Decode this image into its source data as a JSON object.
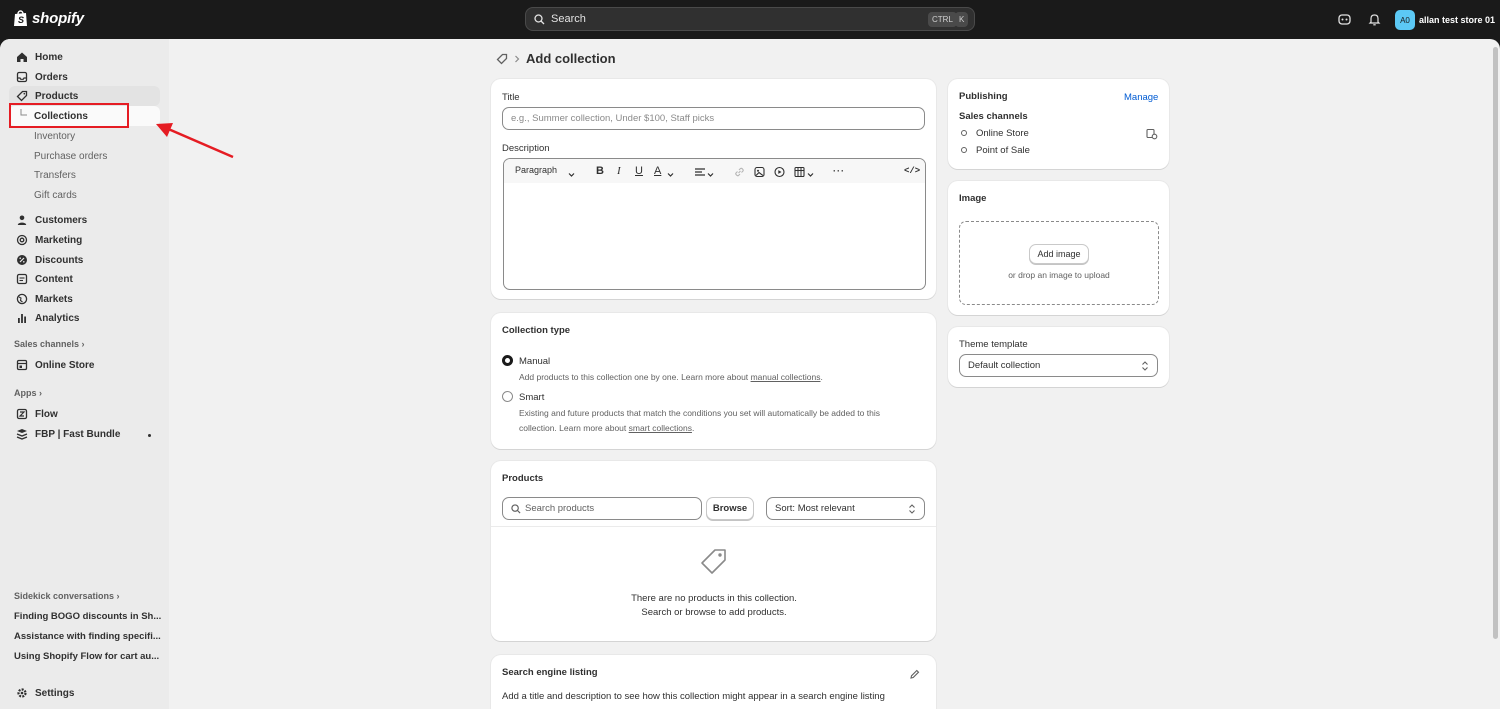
{
  "topbar": {
    "brand": "shopify",
    "search_label": "Search",
    "kbd_ctrl": "CTRL",
    "kbd_k": "K",
    "store_initials": "A0",
    "store_name": "allan test store 01"
  },
  "sidebar": {
    "items": {
      "home": "Home",
      "orders": "Orders",
      "products": "Products",
      "collections": "Collections",
      "inventory": "Inventory",
      "purchase_orders": "Purchase orders",
      "transfers": "Transfers",
      "gift_cards": "Gift cards",
      "customers": "Customers",
      "marketing": "Marketing",
      "discounts": "Discounts",
      "content": "Content",
      "markets": "Markets",
      "analytics": "Analytics"
    },
    "sales_channels_heading": "Sales channels",
    "online_store": "Online Store",
    "apps_heading": "Apps",
    "flow": "Flow",
    "fbp": "FBP | Fast Bundle",
    "sidekick_heading": "Sidekick conversations",
    "conversations": [
      "Finding BOGO discounts in Sh...",
      "Assistance with finding specifi...",
      "Using Shopify Flow for cart au..."
    ],
    "settings": "Settings"
  },
  "page": {
    "title": "Add collection"
  },
  "details": {
    "title_label": "Title",
    "title_placeholder": "e.g., Summer collection, Under $100, Staff picks",
    "description_label": "Description",
    "paragraph": "Paragraph"
  },
  "collection_type": {
    "heading": "Collection type",
    "manual_label": "Manual",
    "manual_help": "Add products to this collection one by one. Learn more about",
    "manual_link": "manual collections",
    "smart_label": "Smart",
    "smart_help_1": "Existing and future products that match the conditions you set will automatically be added to this",
    "smart_help_2": "collection. Learn more about",
    "smart_link": "smart collections",
    "selected": "Manual"
  },
  "products": {
    "heading": "Products",
    "search_placeholder": "Search products",
    "browse": "Browse",
    "sort": "Sort: Most relevant",
    "empty_1": "There are no products in this collection.",
    "empty_2": "Search or browse to add products."
  },
  "seo": {
    "heading": "Search engine listing",
    "text": "Add a title and description to see how this collection might appear in a search engine listing"
  },
  "publishing": {
    "heading": "Publishing",
    "manage": "Manage",
    "sales_channels": "Sales channels",
    "channels": [
      "Online Store",
      "Point of Sale"
    ]
  },
  "image": {
    "heading": "Image",
    "add_button": "Add image",
    "drop_text": "or drop an image to upload"
  },
  "theme": {
    "heading": "Theme template",
    "value": "Default collection"
  },
  "colors": {
    "topbar": "#1a1a1a",
    "background": "#f1f1f1",
    "sidebar": "#ebebeb",
    "link": "#005bd3",
    "annotation": "#e51c23"
  }
}
